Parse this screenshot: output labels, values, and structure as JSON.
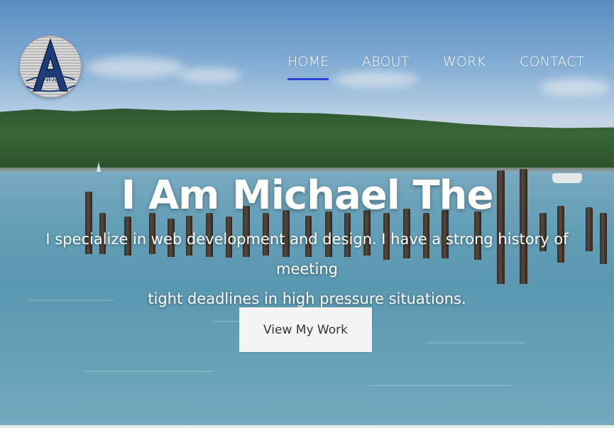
{
  "logo": {
    "letter": "A",
    "monogram": "DWR"
  },
  "nav": {
    "items": [
      {
        "label": "HOME",
        "active": true
      },
      {
        "label": "ABOUT",
        "active": false
      },
      {
        "label": "WORK",
        "active": false
      },
      {
        "label": "CONTACT",
        "active": false
      }
    ]
  },
  "hero": {
    "headline": "I Am Michael The",
    "subtext_line1": "I specialize in web development and design. I have a strong history of meeting",
    "subtext_line2": "tight deadlines in high pressure situations.",
    "cta_label": "View My Work"
  },
  "colors": {
    "nav_active_underline": "#2b43d8",
    "cta_background": "#f4f4f4",
    "text": "#ffffff"
  }
}
